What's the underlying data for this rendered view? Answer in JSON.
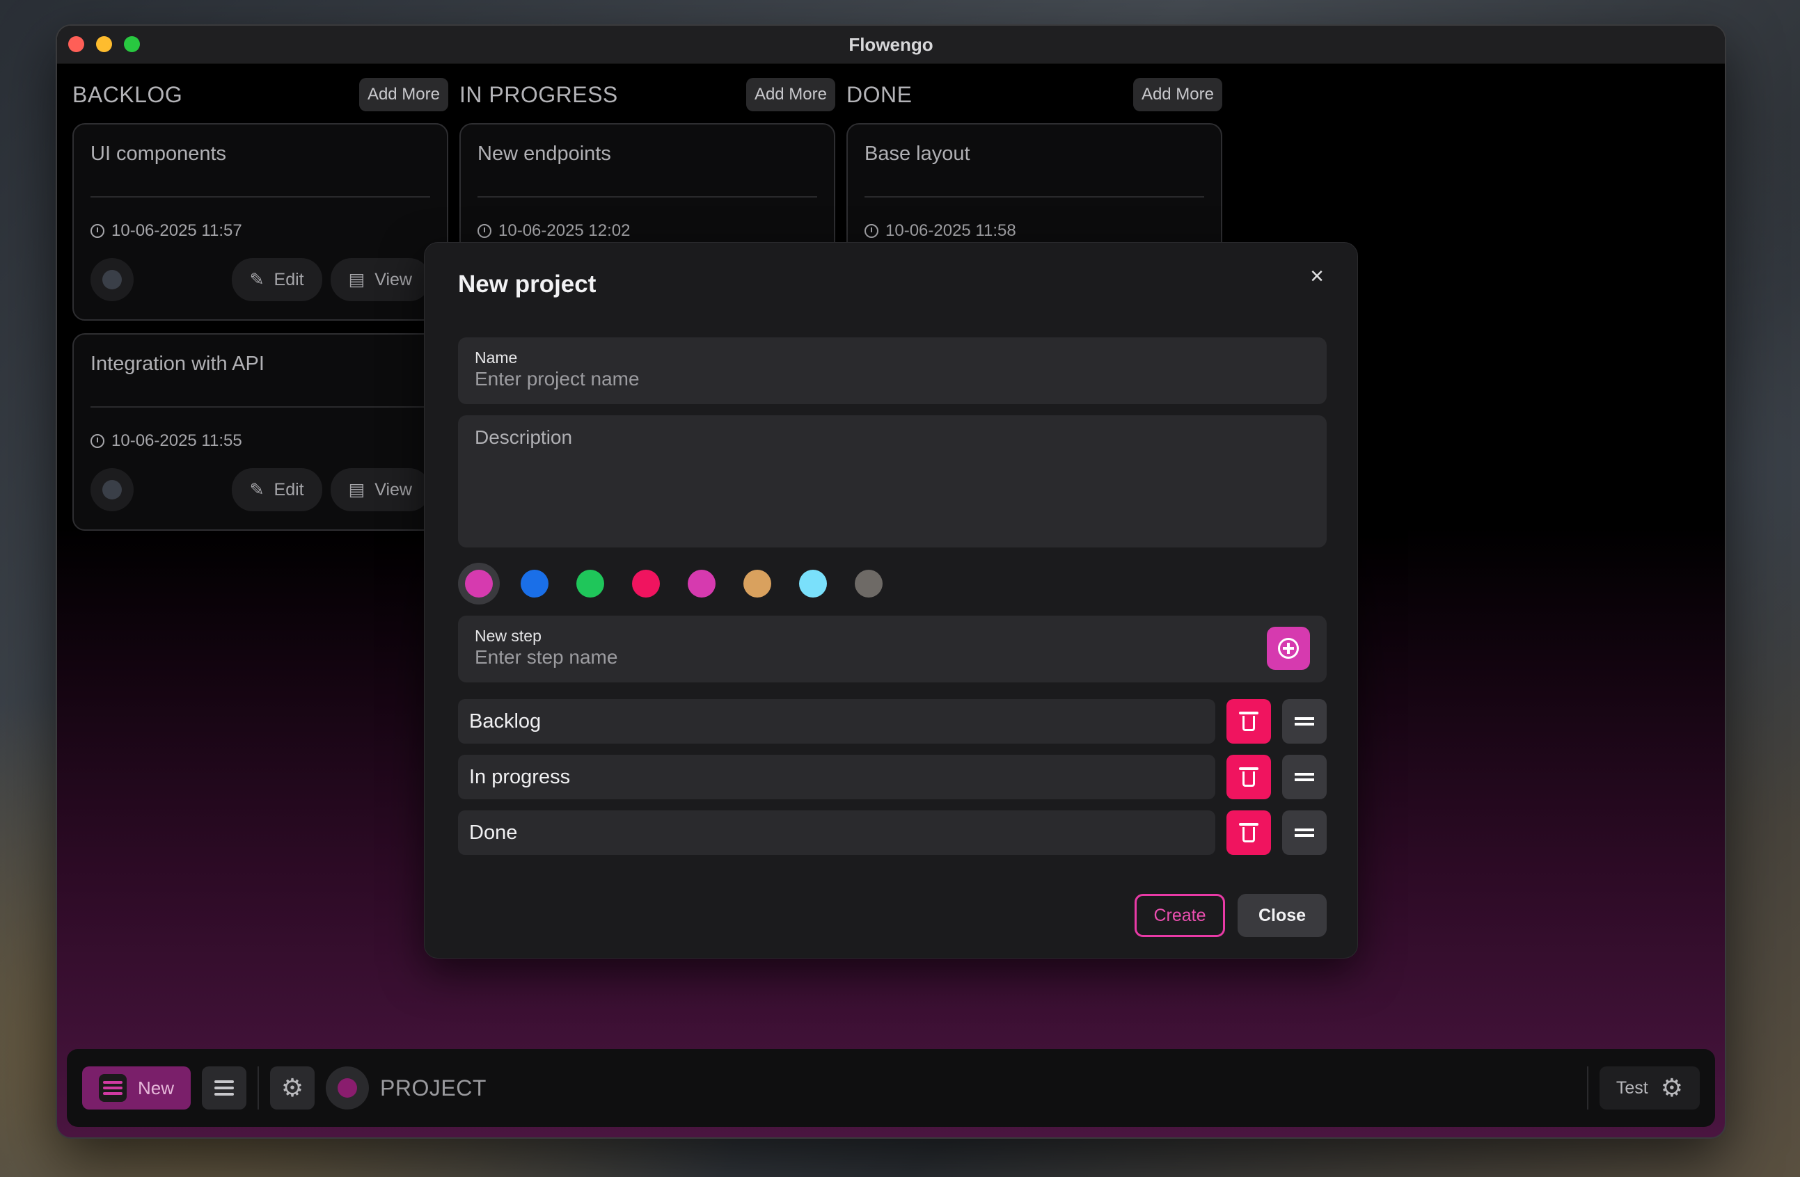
{
  "window": {
    "title": "Flowengo"
  },
  "columns": [
    {
      "title": "BACKLOG",
      "add_label": "Add More",
      "cards": [
        {
          "title": "UI components",
          "date": "10-06-2025 11:57",
          "edit_label": "Edit",
          "view_label": "View"
        },
        {
          "title": "Integration with API",
          "date": "10-06-2025 11:55",
          "edit_label": "Edit",
          "view_label": "View"
        }
      ]
    },
    {
      "title": "IN PROGRESS",
      "add_label": "Add More",
      "cards": [
        {
          "title": "New endpoints",
          "date": "10-06-2025 12:02"
        }
      ]
    },
    {
      "title": "DONE",
      "add_label": "Add More",
      "cards": [
        {
          "title": "Base layout",
          "date": "10-06-2025 11:58"
        }
      ]
    }
  ],
  "modal": {
    "title": "New project",
    "close_icon": "×",
    "name_label": "Name",
    "name_placeholder": "Enter project name",
    "name_value": "",
    "description_placeholder": "Description",
    "description_value": "",
    "colors": [
      "#d63aaf",
      "#1a6fe8",
      "#1fc65a",
      "#f0145f",
      "#d63aaf",
      "#d9a15e",
      "#7ae0fb",
      "#6e6a66"
    ],
    "selected_color_index": 0,
    "step_label": "New step",
    "step_placeholder": "Enter step name",
    "steps": [
      "Backlog",
      "In progress",
      "Done"
    ],
    "create_label": "Create",
    "close_label": "Close"
  },
  "bottombar": {
    "new_label": "New",
    "project_label": "PROJECT",
    "test_label": "Test"
  },
  "colors": {
    "accent": "#d63aaf",
    "danger": "#f0145f"
  }
}
